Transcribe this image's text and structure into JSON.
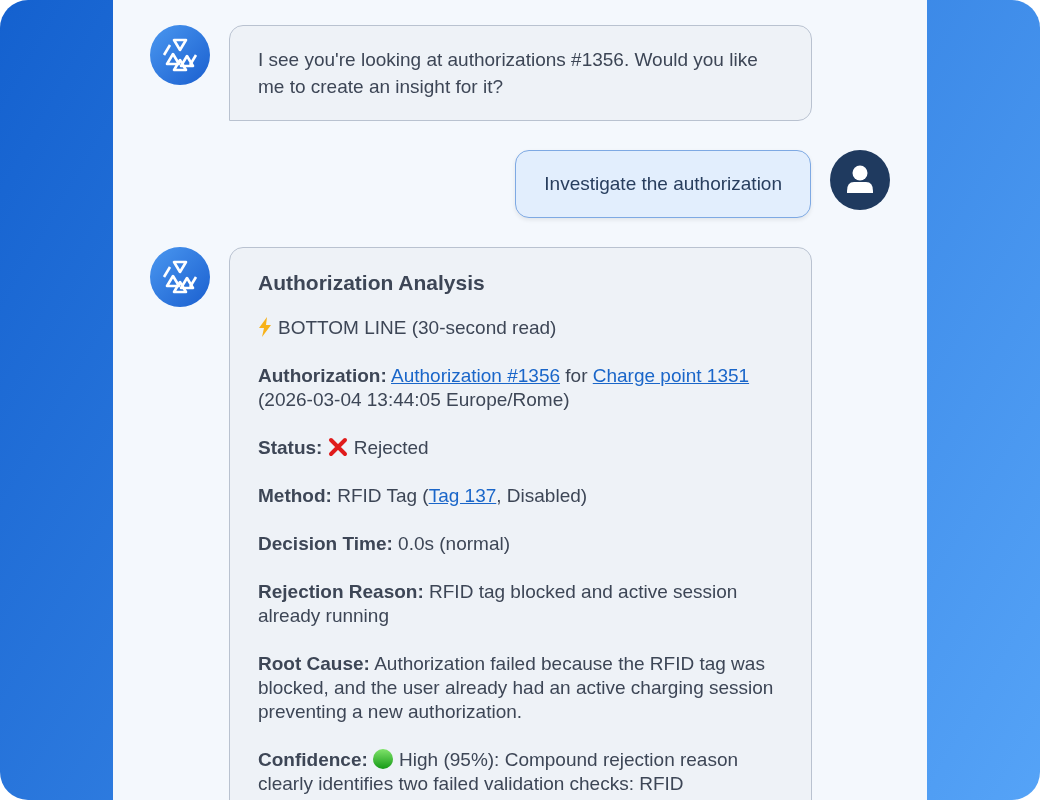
{
  "messages": [
    {
      "kind": "bot",
      "text": "I see you're looking at authorizations #1356. Would you like me to create an insight for it?"
    },
    {
      "kind": "user",
      "text": "Investigate the authorization"
    },
    {
      "kind": "bot_card",
      "title": "Authorization Analysis",
      "paragraphs": [
        {
          "parts": [
            {
              "kind": "bolt"
            },
            {
              "kind": "text",
              "text": "BOTTOM LINE (30-second read)"
            }
          ]
        },
        {
          "parts": [
            {
              "kind": "text",
              "text": "**Authorization:** "
            },
            {
              "kind": "link",
              "text": "Authorization #1356"
            },
            {
              "kind": "text",
              "text": " for "
            },
            {
              "kind": "link",
              "text": "Charge point 1351"
            },
            {
              "kind": "text",
              "text": " (2026-03-04 13:44:05 Europe/Rome)"
            }
          ]
        },
        {
          "parts": [
            {
              "kind": "text",
              "text": "**Status:** "
            },
            {
              "kind": "cross"
            },
            {
              "kind": "text",
              "text": "Rejected"
            }
          ]
        },
        {
          "parts": [
            {
              "kind": "text",
              "text": "**Method:** RFID Tag ("
            },
            {
              "kind": "link",
              "text": "Tag 137"
            },
            {
              "kind": "text",
              "text": ", Disabled)"
            }
          ]
        },
        {
          "parts": [
            {
              "kind": "text",
              "text": "**Decision Time:** 0.0s (normal)"
            }
          ]
        },
        {
          "parts": [
            {
              "kind": "text",
              "text": "**Rejection Reason:** RFID tag blocked and active session already running"
            }
          ]
        },
        {
          "parts": [
            {
              "kind": "text",
              "text": "**Root Cause:** Authorization failed because the RFID tag was blocked, and the user already had an active charging session preventing a new authorization."
            }
          ]
        },
        {
          "parts": [
            {
              "kind": "text",
              "text": "**Confidence:** "
            },
            {
              "kind": "dot"
            },
            {
              "kind": "text",
              "text": "High (95%): Compound rejection reason clearly identifies two failed validation checks: RFID"
            }
          ]
        }
      ]
    }
  ]
}
